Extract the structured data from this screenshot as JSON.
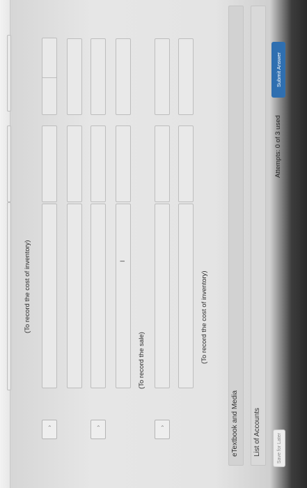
{
  "entries": {
    "cost_of_inventory_label_1": "(To record the cost of inventory)",
    "sale_label": "(To record the sale)",
    "cost_of_inventory_label_2": "(To record the cost of inventory)"
  },
  "links": {
    "etextbook": "eTextbook and Media",
    "list_of_accounts": "List of Accounts"
  },
  "footer": {
    "save_label": "Save for Later",
    "attempts": "Attempts: 0 of 3 used",
    "submit_label": "Submit Answer"
  },
  "icons": {
    "dropdown": "chevron-down-icon",
    "text_cursor": "i-beam-cursor-icon"
  },
  "colors": {
    "submit_button": "#2f6fb0",
    "background": "#e6e6e6"
  }
}
